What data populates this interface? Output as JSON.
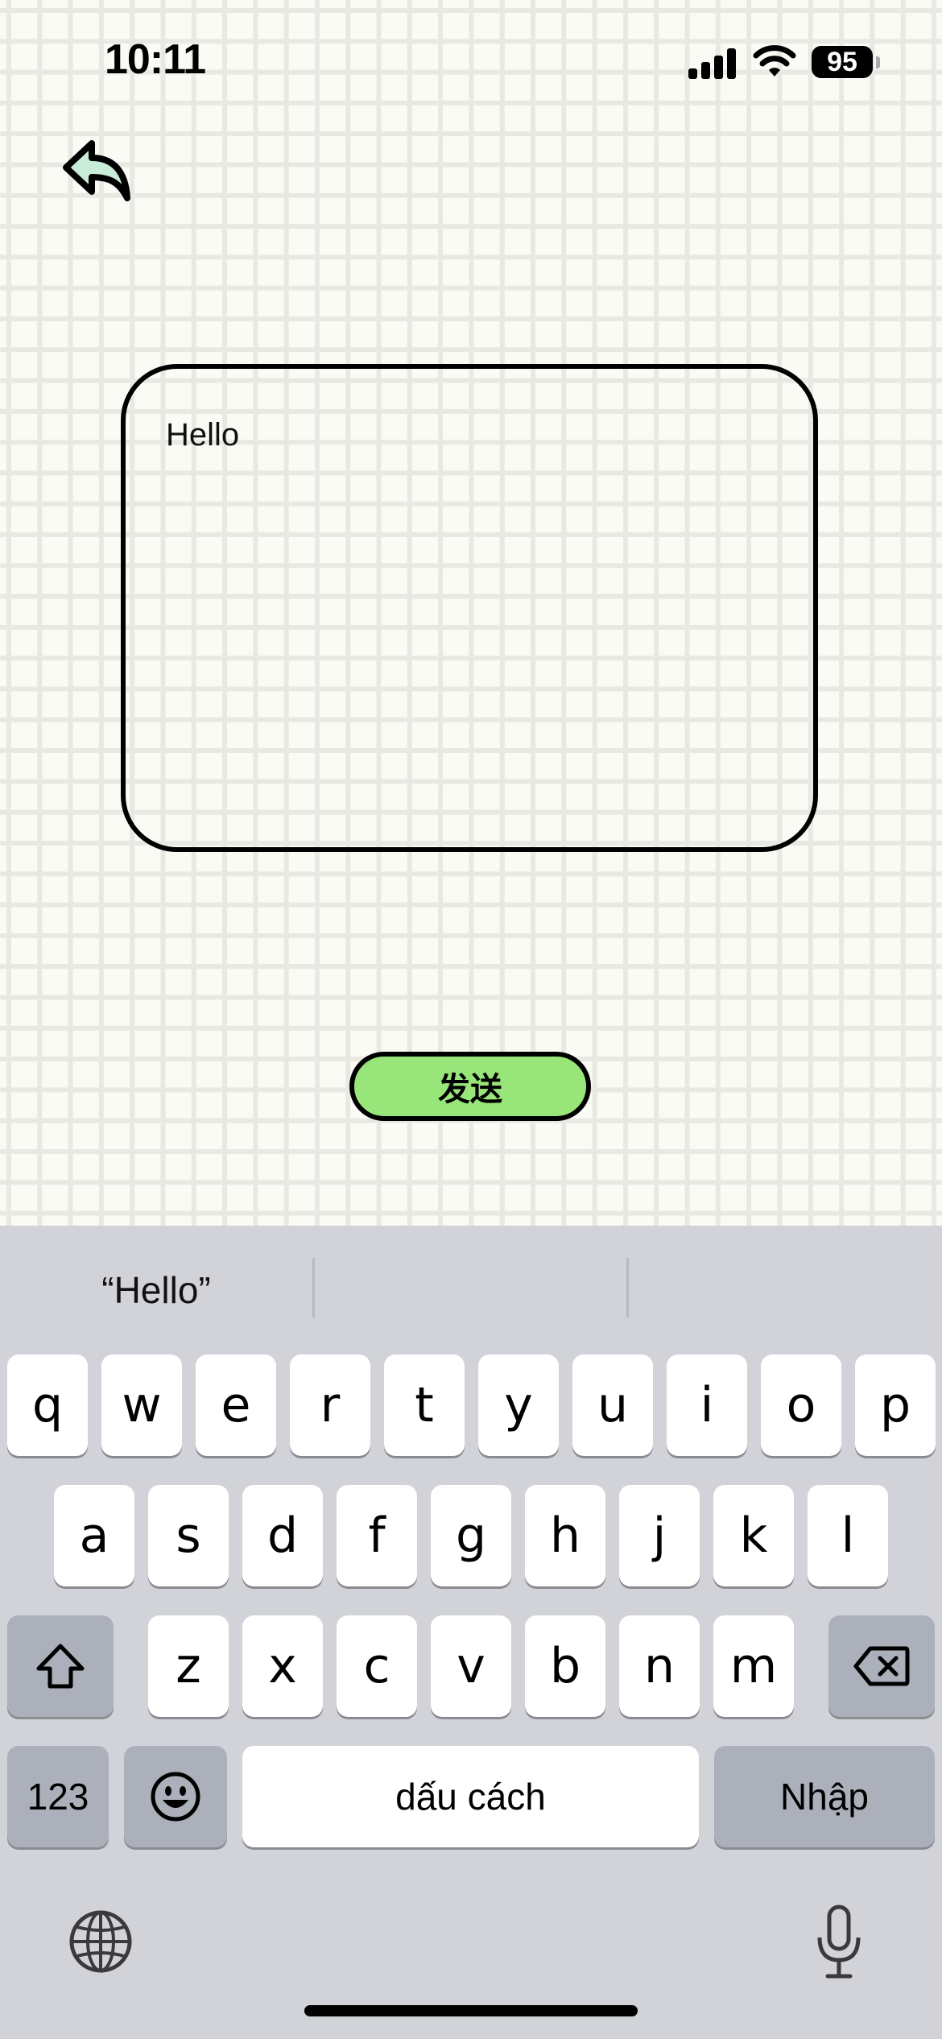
{
  "status_bar": {
    "time": "10:11",
    "battery": "95"
  },
  "editor": {
    "text": "Hello"
  },
  "send_button": {
    "label": "发送"
  },
  "keyboard": {
    "suggestion": "“Hello”",
    "row1": [
      "q",
      "w",
      "e",
      "r",
      "t",
      "y",
      "u",
      "i",
      "o",
      "p"
    ],
    "row2": [
      "a",
      "s",
      "d",
      "f",
      "g",
      "h",
      "j",
      "k",
      "l"
    ],
    "row3": [
      "z",
      "x",
      "c",
      "v",
      "b",
      "n",
      "m"
    ],
    "numbers_label": "123",
    "space_label": "dấu cách",
    "return_label": "Nhập"
  },
  "colors": {
    "send_button": "#98e57a",
    "background": "#fbfbf6",
    "keyboard": "#d1d3d9"
  }
}
